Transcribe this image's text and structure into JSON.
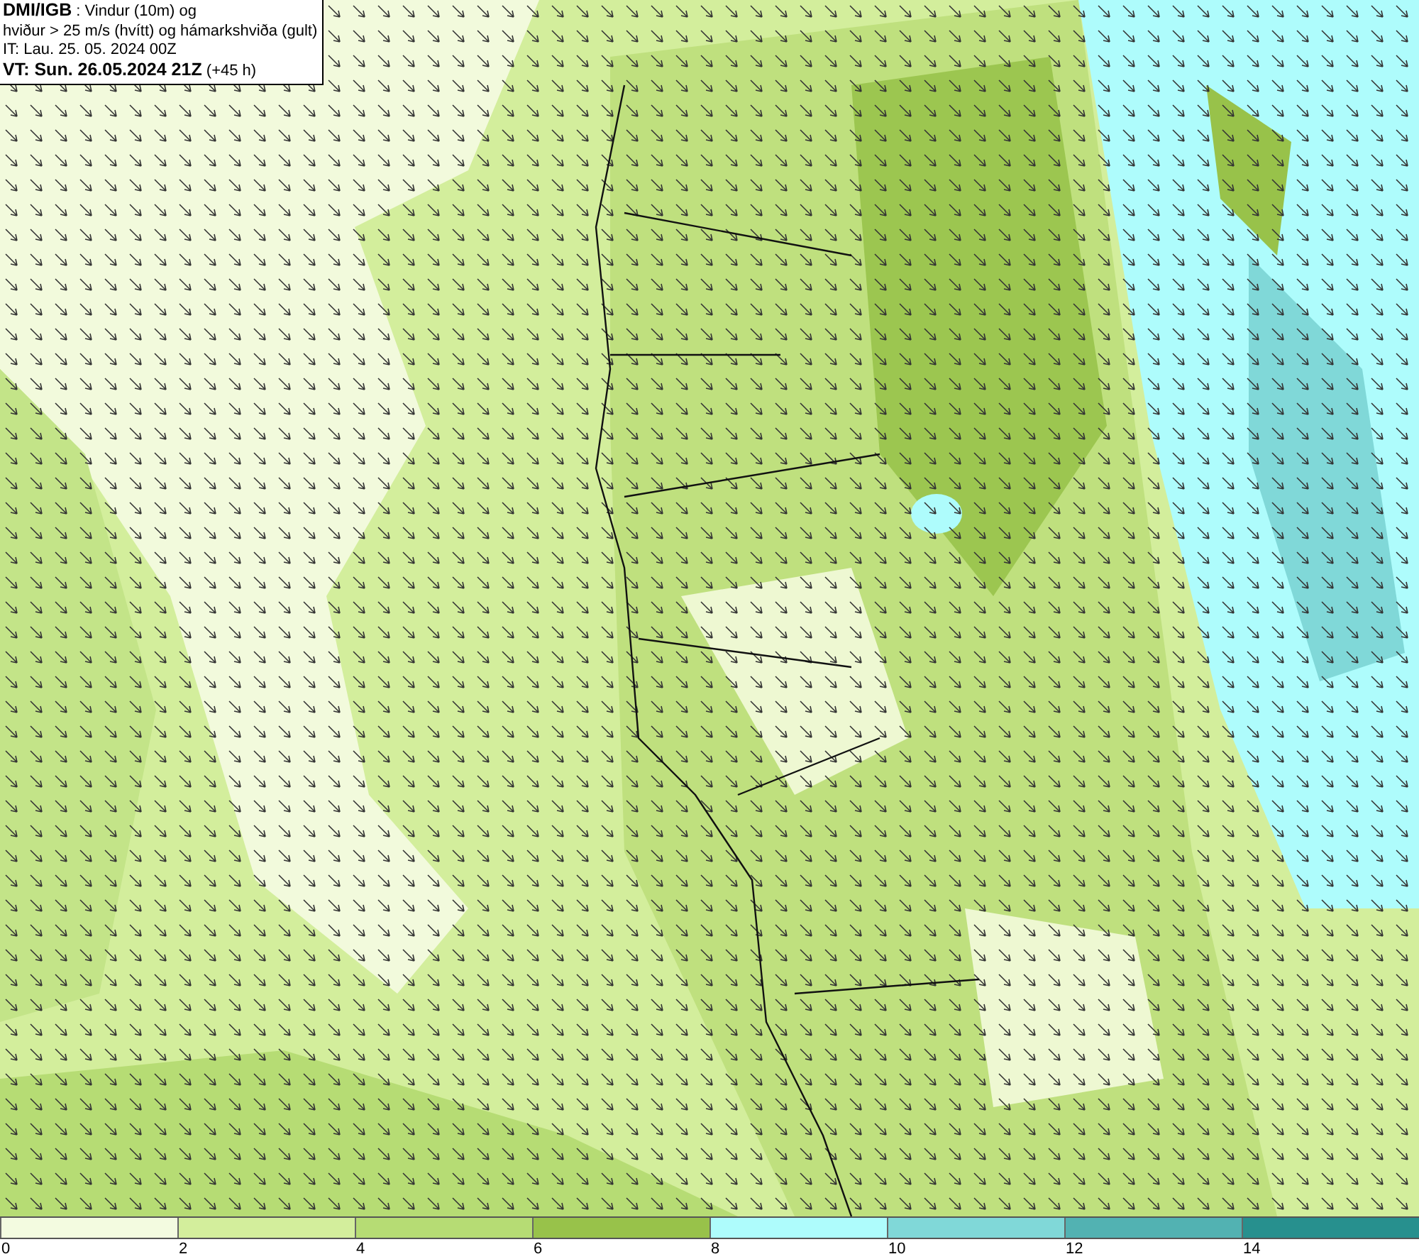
{
  "legend": {
    "lines": [
      "**DMI/IGB** : Vindur (10m) og",
      "hviður > 25 m/s (hvítt) og hámarkshviða (gult)",
      "IT: Lau. 25. 05. 2024 00Z",
      "**VT: Sun. 26.05.2024 21Z** (+45 h)"
    ]
  },
  "colorbar": {
    "bins": [
      {
        "color": "#f3fbe0"
      },
      {
        "color": "#d3ee9c"
      },
      {
        "color": "#b6dc74"
      },
      {
        "color": "#98c24a"
      },
      {
        "color": "#aefcfc"
      },
      {
        "color": "#80d8d8"
      },
      {
        "color": "#52b2b2"
      },
      {
        "color": "#27908e"
      }
    ],
    "labels": [
      "0",
      "2",
      "4",
      "6",
      "8",
      "10",
      "12",
      "14"
    ]
  }
}
